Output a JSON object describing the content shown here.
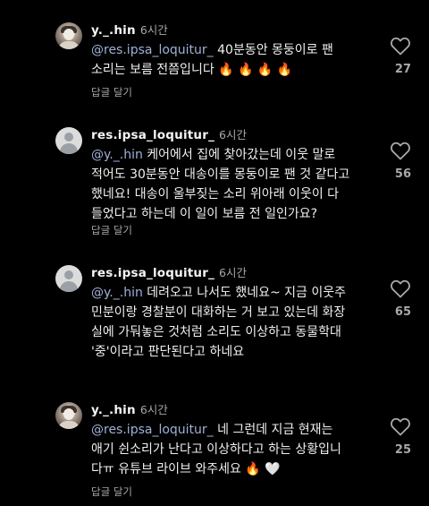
{
  "comments": [
    {
      "username": "y._.hin",
      "time": "6시간",
      "mention": "@res.ipsa_loquitur_",
      "text_line1": " 40분동안 몽둥이로 팬",
      "text_line2": "소리는 보름 전쯤입니다 🔥 🔥 🔥 🔥",
      "reply_label": "답글 달기",
      "likes": "27",
      "avatar": "photo-avatar"
    },
    {
      "username": "res.ipsa_loquitur_",
      "time": "6시간",
      "mention": "@y._.hin",
      "text_line1": " 케어에서 집에 찾아갔는데 이웃 말로",
      "text_line2": "적어도 30분동안 대송이를 몽둥이로 팬 것 같다고",
      "text_line3": "했네요! 대송이 울부짖는 소리 위아래 이웃이 다",
      "text_line4": "들었다고 하는데 이 일이 보름 전 일인가요?",
      "reply_label": "답글 달기",
      "likes": "56",
      "avatar": "default-avatar"
    },
    {
      "username": "res.ipsa_loquitur_",
      "time": "6시간",
      "mention": "@y._.hin",
      "text_line1": " 데려오고 나서도 했네요~ 지금 이웃주",
      "text_line2": "민분이랑 경찰분이 대화하는 거 보고 있는데 화장",
      "text_line3": "실에 가둬놓은 것처럼 소리도 이상하고 동물학대",
      "text_line4": "'중'이라고 판단된다고 하네요",
      "likes": "65",
      "avatar": "default-avatar"
    },
    {
      "username": "y._.hin",
      "time": "6시간",
      "mention": "@res.ipsa_loquitur_",
      "text_line1": " 네 그런데 지금 현재는",
      "text_line2": "애기 쉰소리가 난다고 이상하다고 하는 상황입니",
      "text_line3": "다ㅠ 유튜브 라이브 와주세요 🔥 🤍",
      "reply_label": "답글 달기",
      "likes": "25",
      "avatar": "photo-avatar"
    }
  ],
  "colors": {
    "background": "#000000",
    "text": "#f0f0f0",
    "mention": "#9fb0d8",
    "muted": "#a8a8a8"
  },
  "icons": {
    "like": "heart-outline-icon"
  }
}
